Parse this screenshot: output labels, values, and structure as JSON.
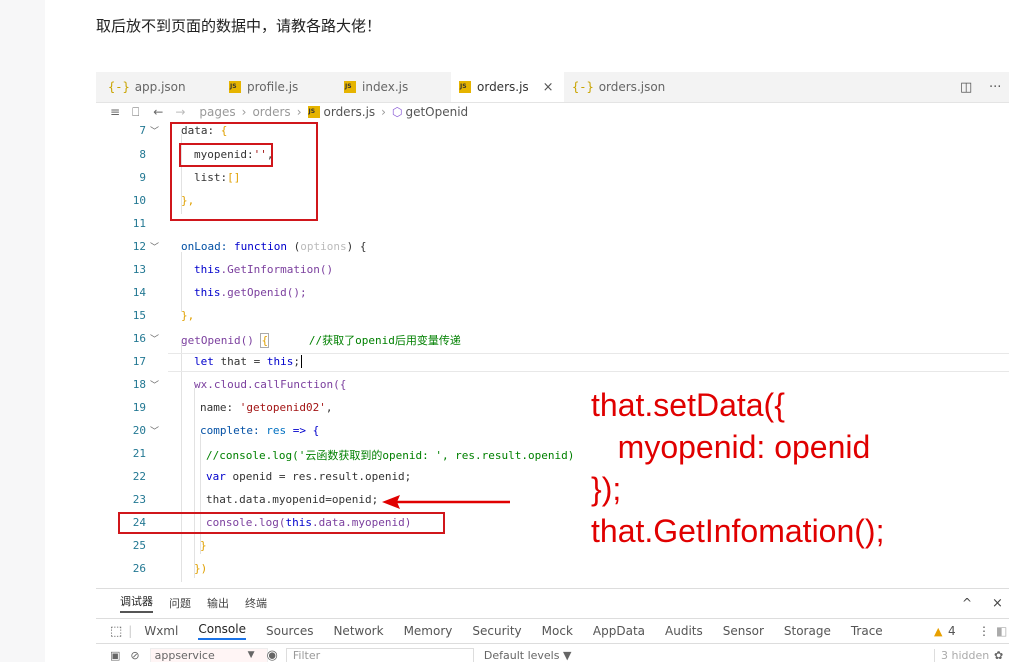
{
  "question": "取后放不到页面的数据中，请教各路大佬！",
  "tabs": [
    {
      "label": "app.json",
      "icon": "{-}"
    },
    {
      "label": "profile.js",
      "icon": "js"
    },
    {
      "label": "index.js",
      "icon": "js"
    },
    {
      "label": "orders.js",
      "icon": "js"
    },
    {
      "label": "orders.json",
      "icon": "{-}"
    }
  ],
  "active_tab_close": "×",
  "toolbar_right": {
    "split_icon": "◫",
    "more_icon": "···"
  },
  "breadcrumb": [
    "pages",
    "orders",
    "orders.js",
    "getOpenid"
  ],
  "breadcrumb_icons": {
    "list": "≡",
    "bookmark": "⎕",
    "back": "←",
    "forward": "→"
  },
  "lines": [
    {
      "n": "7",
      "fold": true
    },
    {
      "n": "8"
    },
    {
      "n": "9"
    },
    {
      "n": "10"
    },
    {
      "n": "11"
    },
    {
      "n": "12",
      "fold": true
    },
    {
      "n": "13"
    },
    {
      "n": "14"
    },
    {
      "n": "15"
    },
    {
      "n": "16",
      "fold": true
    },
    {
      "n": "17"
    },
    {
      "n": "18",
      "fold": true
    },
    {
      "n": "19"
    },
    {
      "n": "20",
      "fold": true
    },
    {
      "n": "21"
    },
    {
      "n": "22"
    },
    {
      "n": "23"
    },
    {
      "n": "24"
    },
    {
      "n": "25"
    },
    {
      "n": "26"
    }
  ],
  "code": {
    "l7": [
      "data: ",
      "{"
    ],
    "l8": [
      "myopenid:",
      "''",
      ","
    ],
    "l9": [
      "list:",
      "[]"
    ],
    "l10": [
      "},"
    ],
    "l12": [
      "onLoad: ",
      "function",
      " (",
      "options",
      ") {"
    ],
    "l13": [
      "this",
      ".GetInformation()"
    ],
    "l14": [
      "this",
      ".getOpenid();"
    ],
    "l15": [
      "},"
    ],
    "l16": [
      "getOpenid() ",
      "{",
      "      //获取了openid后用变量传递"
    ],
    "l17": [
      "let",
      " that = ",
      "this",
      ";"
    ],
    "l18": [
      "wx.cloud.callFunction({"
    ],
    "l19": [
      "name: ",
      "'getopenid02'",
      ","
    ],
    "l20": [
      "complete: ",
      "res",
      " => {"
    ],
    "l21": [
      "//console.log('云函数获取到的openid: ', res.result.openid)"
    ],
    "l22": [
      "var",
      " openid = res.result.openid;"
    ],
    "l23": [
      "that.data.myopenid=openid;"
    ],
    "l24": [
      "console.log(",
      "this",
      ".data.myopenid)"
    ],
    "l25": [
      "}"
    ],
    "l26": [
      "})"
    ]
  },
  "annotation": "that.setData({\n   myopenid: openid\n});\nthat.GetInfomation();",
  "panel_tabs": [
    "调试器",
    "问题",
    "输出",
    "终端"
  ],
  "panel_icons": {
    "collapse": "^",
    "close": "×"
  },
  "devtools_tabs": [
    "Wxml",
    "Console",
    "Sources",
    "Network",
    "Memory",
    "Security",
    "Mock",
    "AppData",
    "Audits",
    "Sensor",
    "Storage",
    "Trace"
  ],
  "devtools_active": "Console",
  "warnings": "4",
  "console": {
    "context": "appservice",
    "filter_placeholder": "Filter",
    "levels": "Default levels ▼",
    "hidden": "3 hidden"
  },
  "colors": {
    "annotation": "#e00000",
    "redbox": "#d0161b"
  }
}
